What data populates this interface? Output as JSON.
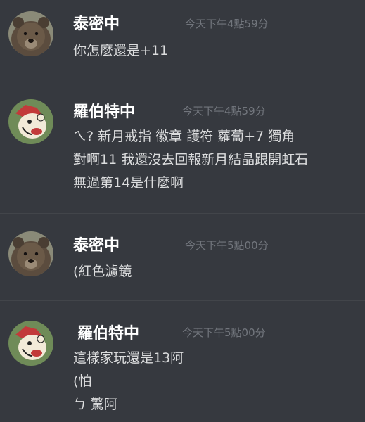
{
  "messages": [
    {
      "author": "泰密中",
      "avatar": "bear-avatar",
      "time": "今天下午4點59分",
      "lines": [
        "你怎麼還是+11"
      ]
    },
    {
      "author": "羅伯特中",
      "avatar": "cartoon-avatar",
      "time": "今天下午4點59分",
      "lines": [
        "ㄟ? 新月戒指 徽章 護符 蘿蔔+7 獨角",
        "對啊11  我還沒去回報新月結晶跟開虹石",
        "無過第14是什麼啊"
      ]
    },
    {
      "author": "泰密中",
      "avatar": "bear-avatar",
      "time": "今天下午5點00分",
      "lines": [
        "(紅色濾鏡"
      ]
    },
    {
      "author": "羅伯特中",
      "avatar": "cartoon-avatar",
      "time": "今天下午5點00分",
      "lines": [
        "這樣家玩還是13阿",
        "(怕",
        "ㄅ 驚阿"
      ]
    }
  ],
  "colors": {
    "background": "#36393f",
    "author": "#ffffff",
    "timestamp": "#72767d",
    "text": "#dcddde"
  }
}
